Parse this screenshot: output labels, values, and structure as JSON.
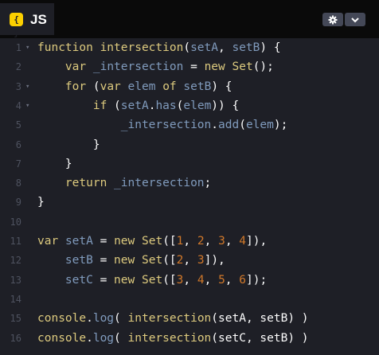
{
  "panel": {
    "language_badge": "{ }",
    "language_label": "JS",
    "settings_icon": "gear-icon",
    "collapse_icon": "chevron-down-icon"
  },
  "code_lines": [
    {
      "n": "1",
      "fold": true,
      "tokens": [
        {
          "t": "function",
          "c": "kw"
        },
        {
          "t": " ",
          "c": "pl"
        },
        {
          "t": "intersection",
          "c": "fn"
        },
        {
          "t": "(",
          "c": "pu"
        },
        {
          "t": "setA",
          "c": "var"
        },
        {
          "t": ", ",
          "c": "pu"
        },
        {
          "t": "setB",
          "c": "var"
        },
        {
          "t": ") {",
          "c": "pu"
        }
      ]
    },
    {
      "n": "2",
      "fold": false,
      "tokens": [
        {
          "t": "    ",
          "c": "pl"
        },
        {
          "t": "var",
          "c": "kw"
        },
        {
          "t": " ",
          "c": "pl"
        },
        {
          "t": "_intersection",
          "c": "var"
        },
        {
          "t": " = ",
          "c": "op"
        },
        {
          "t": "new",
          "c": "kw"
        },
        {
          "t": " ",
          "c": "pl"
        },
        {
          "t": "Set",
          "c": "fn"
        },
        {
          "t": "();",
          "c": "pu"
        }
      ]
    },
    {
      "n": "3",
      "fold": true,
      "tokens": [
        {
          "t": "    ",
          "c": "pl"
        },
        {
          "t": "for",
          "c": "kw"
        },
        {
          "t": " (",
          "c": "pu"
        },
        {
          "t": "var",
          "c": "kw"
        },
        {
          "t": " ",
          "c": "pl"
        },
        {
          "t": "elem",
          "c": "var"
        },
        {
          "t": " ",
          "c": "pl"
        },
        {
          "t": "of",
          "c": "kw"
        },
        {
          "t": " ",
          "c": "pl"
        },
        {
          "t": "setB",
          "c": "var"
        },
        {
          "t": ") {",
          "c": "pu"
        }
      ]
    },
    {
      "n": "4",
      "fold": true,
      "tokens": [
        {
          "t": "        ",
          "c": "pl"
        },
        {
          "t": "if",
          "c": "kw"
        },
        {
          "t": " (",
          "c": "pu"
        },
        {
          "t": "setA",
          "c": "var"
        },
        {
          "t": ".",
          "c": "pu"
        },
        {
          "t": "has",
          "c": "var"
        },
        {
          "t": "(",
          "c": "pu"
        },
        {
          "t": "elem",
          "c": "var"
        },
        {
          "t": ")) {",
          "c": "pu"
        }
      ]
    },
    {
      "n": "5",
      "fold": false,
      "tokens": [
        {
          "t": "            ",
          "c": "pl"
        },
        {
          "t": "_intersection",
          "c": "var"
        },
        {
          "t": ".",
          "c": "pu"
        },
        {
          "t": "add",
          "c": "var"
        },
        {
          "t": "(",
          "c": "pu"
        },
        {
          "t": "elem",
          "c": "var"
        },
        {
          "t": ");",
          "c": "pu"
        }
      ]
    },
    {
      "n": "6",
      "fold": false,
      "tokens": [
        {
          "t": "        ",
          "c": "pl"
        },
        {
          "t": "}",
          "c": "pu"
        }
      ]
    },
    {
      "n": "7",
      "fold": false,
      "tokens": [
        {
          "t": "    ",
          "c": "pl"
        },
        {
          "t": "}",
          "c": "pu"
        }
      ]
    },
    {
      "n": "8",
      "fold": false,
      "tokens": [
        {
          "t": "    ",
          "c": "pl"
        },
        {
          "t": "return",
          "c": "kw"
        },
        {
          "t": " ",
          "c": "pl"
        },
        {
          "t": "_intersection",
          "c": "var"
        },
        {
          "t": ";",
          "c": "pu"
        }
      ]
    },
    {
      "n": "9",
      "fold": false,
      "tokens": [
        {
          "t": "}",
          "c": "pu"
        }
      ]
    },
    {
      "n": "10",
      "fold": false,
      "tokens": []
    },
    {
      "n": "11",
      "fold": false,
      "tokens": [
        {
          "t": "var",
          "c": "kw"
        },
        {
          "t": " ",
          "c": "pl"
        },
        {
          "t": "setA",
          "c": "var"
        },
        {
          "t": " = ",
          "c": "op"
        },
        {
          "t": "new",
          "c": "kw"
        },
        {
          "t": " ",
          "c": "pl"
        },
        {
          "t": "Set",
          "c": "fn"
        },
        {
          "t": "([",
          "c": "pu"
        },
        {
          "t": "1",
          "c": "num"
        },
        {
          "t": ", ",
          "c": "pu"
        },
        {
          "t": "2",
          "c": "num"
        },
        {
          "t": ", ",
          "c": "pu"
        },
        {
          "t": "3",
          "c": "num"
        },
        {
          "t": ", ",
          "c": "pu"
        },
        {
          "t": "4",
          "c": "num"
        },
        {
          "t": "]),",
          "c": "pu"
        }
      ]
    },
    {
      "n": "12",
      "fold": false,
      "tokens": [
        {
          "t": "    ",
          "c": "pl"
        },
        {
          "t": "setB",
          "c": "var"
        },
        {
          "t": " = ",
          "c": "op"
        },
        {
          "t": "new",
          "c": "kw"
        },
        {
          "t": " ",
          "c": "pl"
        },
        {
          "t": "Set",
          "c": "fn"
        },
        {
          "t": "([",
          "c": "pu"
        },
        {
          "t": "2",
          "c": "num"
        },
        {
          "t": ", ",
          "c": "pu"
        },
        {
          "t": "3",
          "c": "num"
        },
        {
          "t": "]),",
          "c": "pu"
        }
      ]
    },
    {
      "n": "13",
      "fold": false,
      "tokens": [
        {
          "t": "    ",
          "c": "pl"
        },
        {
          "t": "setC",
          "c": "var"
        },
        {
          "t": " = ",
          "c": "op"
        },
        {
          "t": "new",
          "c": "kw"
        },
        {
          "t": " ",
          "c": "pl"
        },
        {
          "t": "Set",
          "c": "fn"
        },
        {
          "t": "([",
          "c": "pu"
        },
        {
          "t": "3",
          "c": "num"
        },
        {
          "t": ", ",
          "c": "pu"
        },
        {
          "t": "4",
          "c": "num"
        },
        {
          "t": ", ",
          "c": "pu"
        },
        {
          "t": "5",
          "c": "num"
        },
        {
          "t": ", ",
          "c": "pu"
        },
        {
          "t": "6",
          "c": "num"
        },
        {
          "t": "]);",
          "c": "pu"
        }
      ]
    },
    {
      "n": "14",
      "fold": false,
      "tokens": []
    },
    {
      "n": "15",
      "fold": false,
      "tokens": [
        {
          "t": "console",
          "c": "pr"
        },
        {
          "t": ".",
          "c": "pu"
        },
        {
          "t": "log",
          "c": "var"
        },
        {
          "t": "( ",
          "c": "pu"
        },
        {
          "t": "intersection",
          "c": "pr"
        },
        {
          "t": "(",
          "c": "pu"
        },
        {
          "t": "setA",
          "c": "tx"
        },
        {
          "t": ", ",
          "c": "pu"
        },
        {
          "t": "setB",
          "c": "tx"
        },
        {
          "t": ") )",
          "c": "pu"
        }
      ]
    },
    {
      "n": "16",
      "fold": false,
      "tokens": [
        {
          "t": "console",
          "c": "pr"
        },
        {
          "t": ".",
          "c": "pu"
        },
        {
          "t": "log",
          "c": "var"
        },
        {
          "t": "( ",
          "c": "pu"
        },
        {
          "t": "intersection",
          "c": "pr"
        },
        {
          "t": "(",
          "c": "pu"
        },
        {
          "t": "setC",
          "c": "tx"
        },
        {
          "t": ", ",
          "c": "pu"
        },
        {
          "t": "setB",
          "c": "tx"
        },
        {
          "t": ") )",
          "c": "pu"
        }
      ]
    }
  ]
}
